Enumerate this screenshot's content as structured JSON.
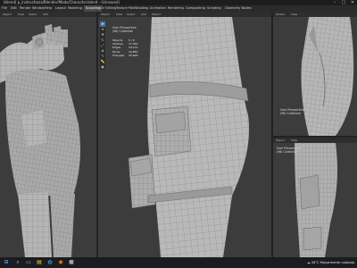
{
  "window": {
    "title": "(blend) p_instructions/Blender/Mods/Character.blend - (Unsaved)",
    "buttons": [
      "–",
      "□",
      "✕"
    ]
  },
  "menu": {
    "items": [
      "File",
      "Edit",
      "Render",
      "Window",
      "Help",
      "Layout",
      "Modeling",
      "Sculpting",
      "UV Editing",
      "Texture Paint",
      "Shading",
      "Animation",
      "Rendering",
      "Compositing",
      "Scripting",
      "Geometry Nodes"
    ],
    "active_index": 7
  },
  "viewports": {
    "left": {
      "header": [
        "Object",
        "View",
        "Select",
        "Add"
      ]
    },
    "center": {
      "header": [
        "Object",
        "View",
        "Select",
        "Add",
        "Object"
      ],
      "overlay_title": "User Perspective",
      "overlay_collection": "(98) Collection",
      "stats": [
        {
          "k": "Objects",
          "v": "0 / 6"
        },
        {
          "k": "Vertices",
          "v": "17,452"
        },
        {
          "k": "Edges",
          "v": "34,131"
        },
        {
          "k": "Faces",
          "v": "16,887"
        },
        {
          "k": "Triangles",
          "v": "33,626"
        }
      ],
      "tools": [
        "arrow-icon",
        "cursor-icon",
        "move-icon",
        "rotate-icon",
        "scale-icon",
        "transform-icon",
        "annotate-icon",
        "measure-icon",
        "add-cube-icon"
      ]
    },
    "top_right": {
      "header": [
        "Global",
        "View"
      ],
      "overlay_title": "User Perspective",
      "overlay_collection": "(98) Collection"
    },
    "bottom_right": {
      "header": [
        "Object",
        "View"
      ],
      "overlay_title": "User Perspective",
      "overlay_collection": "(98) Collection"
    }
  },
  "taskbar": {
    "icons": [
      "windows-icon",
      "search-icon",
      "task-view-icon",
      "file-explorer-icon",
      "browser-icon",
      "blender-icon",
      "app-icon"
    ],
    "weather_temp": "34°C",
    "weather_desc": "Mayormente nublado"
  },
  "colors": {
    "viewport_bg": "#3c3c3c",
    "mesh": "#b3b3b3",
    "wire": "#7f7f7f",
    "accent": "#4f6f9b"
  }
}
